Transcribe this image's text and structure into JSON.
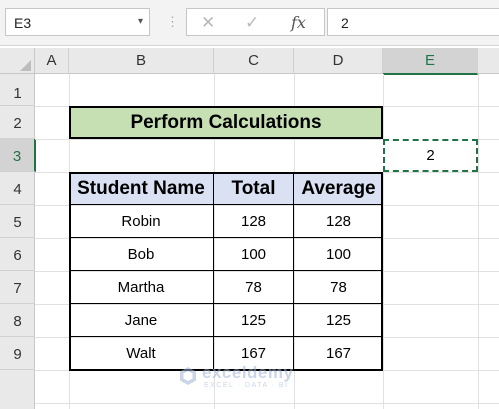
{
  "formula_bar": {
    "name_box": "E3",
    "name_box_arrow": "▾",
    "separator": "⋮",
    "cancel_icon": "✕",
    "enter_icon": "✓",
    "function_icon": "fx",
    "formula_value": "2"
  },
  "columns": [
    "A",
    "B",
    "C",
    "D",
    "E"
  ],
  "rows": [
    "1",
    "2",
    "3",
    "4",
    "5",
    "6",
    "7",
    "8",
    "9"
  ],
  "selected_cell": {
    "column": "E",
    "row": "3",
    "value": "2"
  },
  "sheet": {
    "title": "Perform Calculations",
    "headers": [
      "Student Name",
      "Total",
      "Average"
    ],
    "records": [
      [
        "Robin",
        "128",
        "128"
      ],
      [
        "Bob",
        "100",
        "100"
      ],
      [
        "Martha",
        "78",
        "78"
      ],
      [
        "Jane",
        "125",
        "125"
      ],
      [
        "Walt",
        "167",
        "167"
      ]
    ]
  },
  "watermark": {
    "name": "exceldemy",
    "tagline": "EXCEL · DATA · BI"
  },
  "colors": {
    "title_fill": "#c6e0b4",
    "header_fill": "#d9e1f2",
    "selection_accent": "#217346"
  }
}
